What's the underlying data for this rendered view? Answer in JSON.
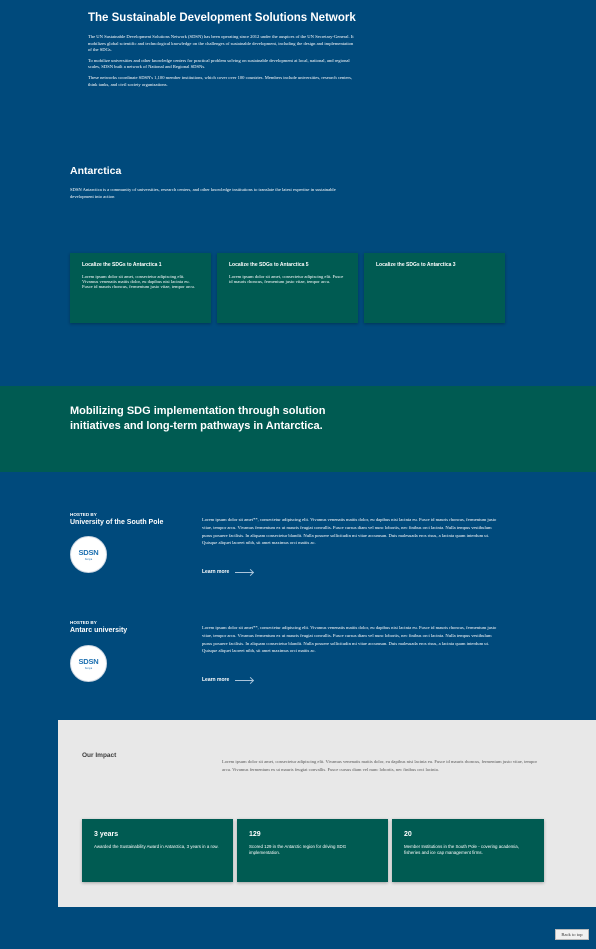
{
  "intro": {
    "title": "The Sustainable Development Solutions Network",
    "paragraphs": [
      "The UN Sustainable Development Solutions Network (SDSN) has been operating since 2012 under the auspices of the UN Secretary-General. It mobilizes global scientific and technological knowledge on the challenges of sustainable development, including the design and implementation of the SDGs.",
      "To mobilize universities and other knowledge centers for practical problem solving on sustainable development at local, national, and regional scales, SDSN built a network of National and Regional SDSNs.",
      "These networks coordinate SDSN's 1,100 member institutions, which cover over 100 countries. Members include universities, research centers, think tanks, and civil society organizations."
    ]
  },
  "antarctica": {
    "title": "Antarctica",
    "description": "SDSN Antarctica is a community of universities, research centers, and other knowledge institutions to translate the latest expertise in sustainable development into action"
  },
  "cards": [
    {
      "title": "Localize the SDGs to Antarctica 1",
      "text": "Lorem ipsum dolor sit amet, consectetur adipiscing elit. Vivamus venenatis mattis dolor, eu dapibus nisi lacinia eu. Fusce id mauris rhoncus, fermentum justo vitae, tempor arcu."
    },
    {
      "title": "Localize the SDGs to Antarctica 5",
      "text": "Lorem ipsum dolor sit amet, consectetur adipiscing elit. Fusce id mauris rhoncus, fermentum justo vitae, tempor arcu."
    },
    {
      "title": "Localize the SDGs to Antarctica 3",
      "text": ""
    }
  ],
  "banner": {
    "heading": "Mobilizing SDG implementation through solution initiatives and long-term pathways in Antarctica."
  },
  "hosts": [
    {
      "label": "HOSTED BY",
      "name": "University of the South Pole",
      "logo_text": "SDSN",
      "logo_sub": "Kenya",
      "body": "Lorem ipsum dolor sit amet**, consectetur adipiscing elit. Vivamus venenatis mattis dolor, eu dapibus nisi lacinia eu. Fusce id mauris rhoncus, fermentum justo vitae, tempor arcu. Vivamus fermentum ex ut mauris feugiat convallis. Fusce cursus diam vel nunc lobortis, nec finibus orci lacinia. Nulla tempus vestibulum purus posuere facilisis. In aliquam consectetur blandit. Nulla posuere sollicitudin mi vitae accumsan. Duis malesuada eros risus, a lacinia quam interdum ut. Quisque aliquet laoreet nibh, sit amet maximus orci mattis ac.",
      "link": "Learn more"
    },
    {
      "label": "HOSTED BY",
      "name": "Antarc university",
      "logo_text": "SDSN",
      "logo_sub": "Kenya",
      "body": "Lorem ipsum dolor sit amet**, consectetur adipiscing elit. Vivamus venenatis mattis dolor, eu dapibus nisi lacinia eu. Fusce id mauris rhoncus, fermentum justo vitae, tempor arcu. Vivamus fermentum ex ut mauris feugiat convallis. Fusce cursus diam vel nunc lobortis, nec finibus orci lacinia. Nulla tempus vestibulum purus posuere facilisis. In aliquam consectetur blandit. Nulla posuere sollicitudin mi vitae accumsan. Duis malesuada eros risus, a lacinia quam interdum ut. Quisque aliquet laoreet nibh, sit amet maximus orci mattis ac.",
      "link": "Learn more"
    }
  ],
  "impact": {
    "title": "Our Impact",
    "description": "Lorem ipsum dolor sit amet, consectetur adipiscing elit. Vivamus venenatis mattis dolor, eu dapibus nisi lacinia eu. Fusce id mauris rhoncus, fermentum justo vitae, tempor arcu. Vivamus fermentum ex ut mauris feugiat convallis. Fusce cursus diam vel nunc lobortis, nec finibus orci lacinia.",
    "stats": [
      {
        "value": "3 years",
        "text": "Awarded the Sustainability Award in Antarctica, 3 years in a row."
      },
      {
        "value": "129",
        "text": "Scored 129 in the Antarctic region for driving SDG implementation."
      },
      {
        "value": "20",
        "text": "Member Institutions in the South Pole - covering academia, fisheries and ice cap management firms."
      }
    ]
  },
  "footer": {
    "back_to_top": "Back to top"
  },
  "colors": {
    "background": "#004a7c",
    "accent": "#005b52",
    "impact_bg": "#e8e8e8"
  }
}
